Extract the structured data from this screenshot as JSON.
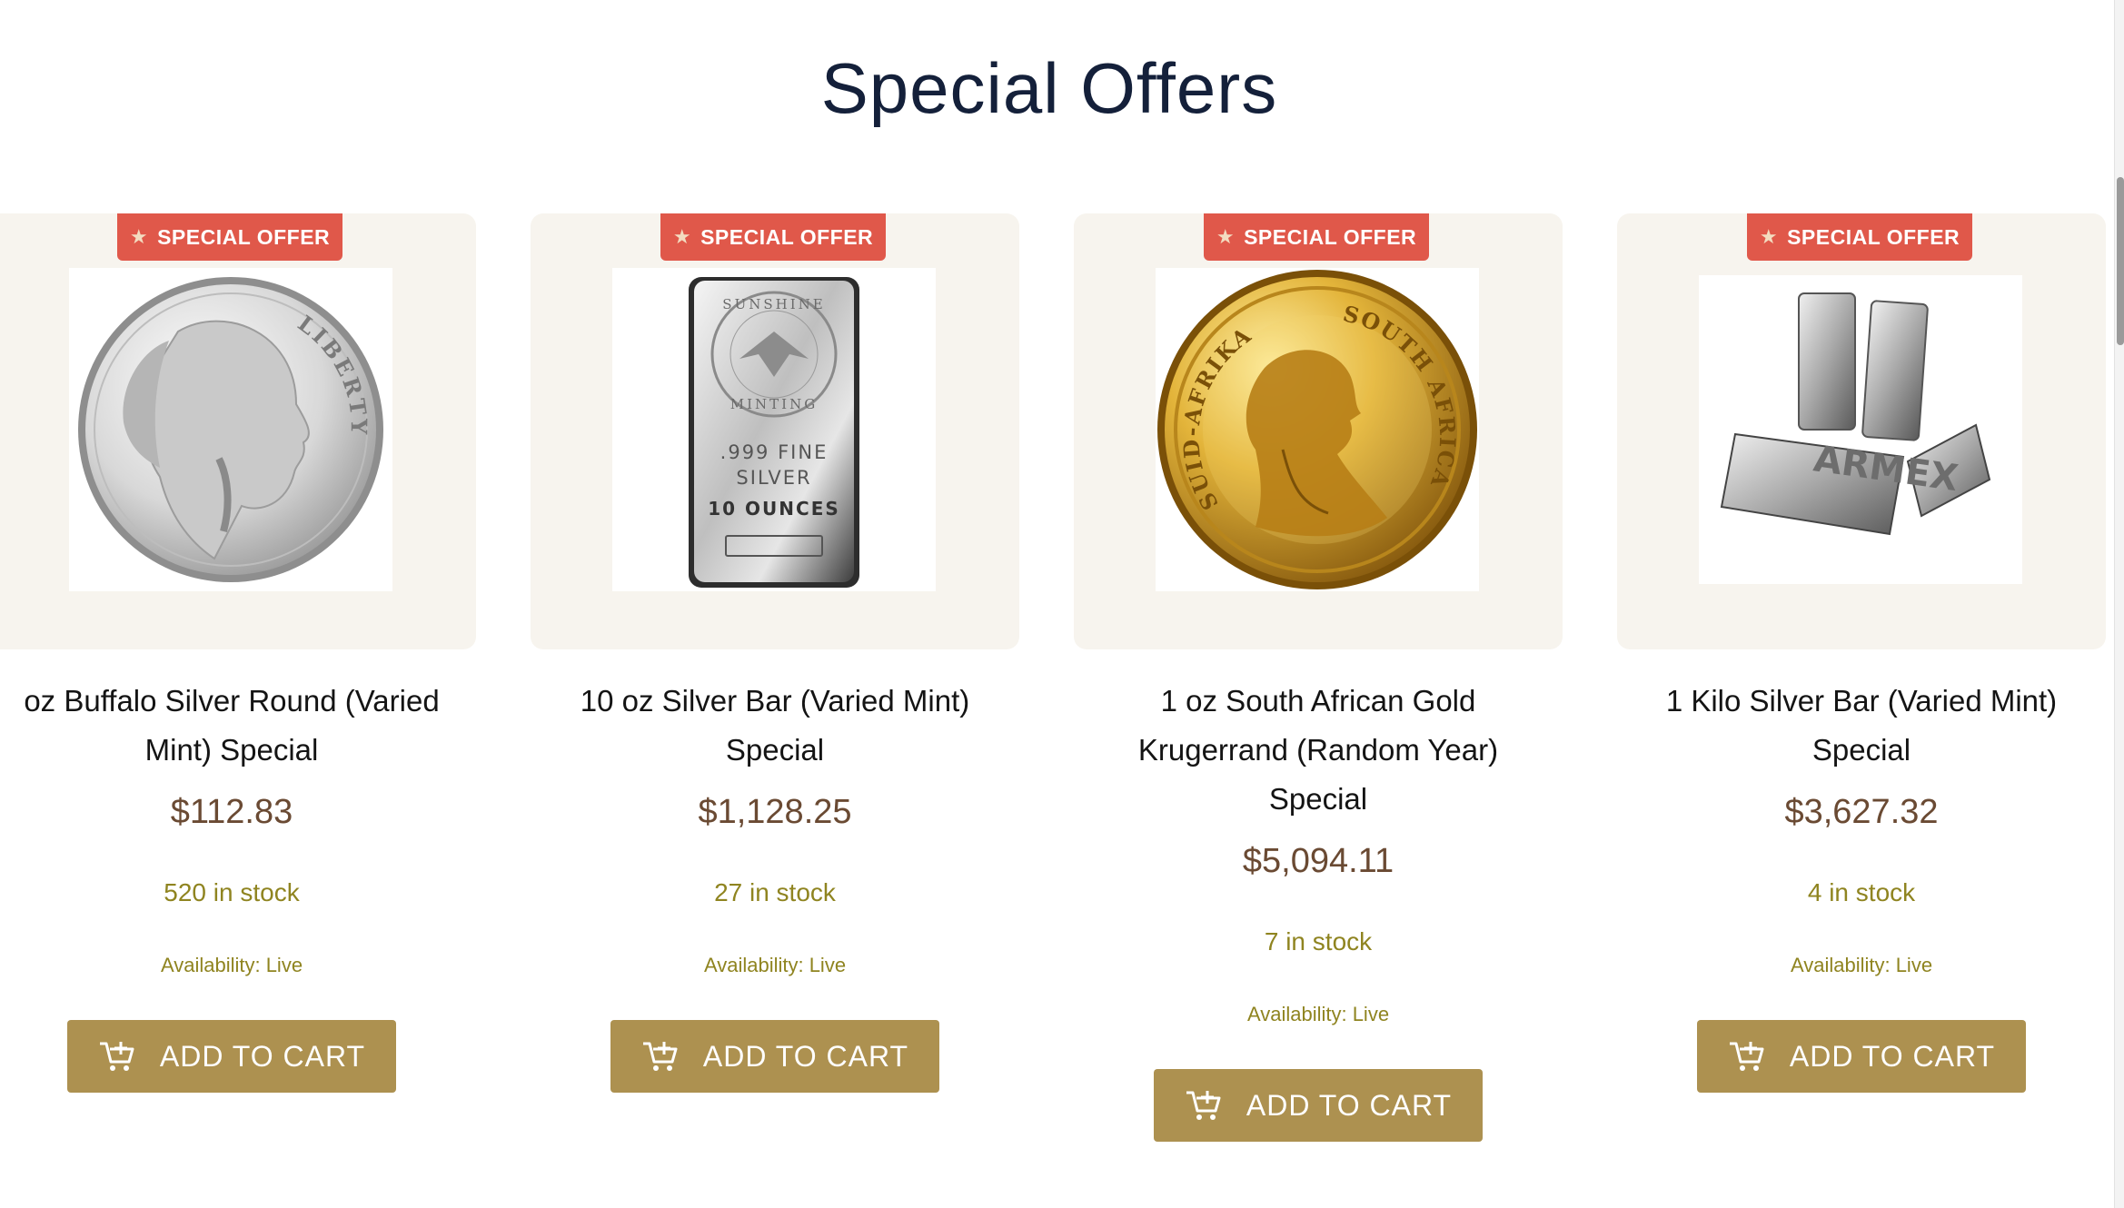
{
  "section": {
    "title": "Special Offers"
  },
  "products": [
    {
      "badge": "SPECIAL OFFER",
      "title_line1": "oz Buffalo Silver Round (Varied",
      "title_line2": "Mint) Special",
      "title_line3": "",
      "price": "$112.83",
      "stock": "520 in stock",
      "availability": "Availability: Live",
      "cart_label": "ADD TO CART",
      "image": "buffalo-silver-round"
    },
    {
      "badge": "SPECIAL OFFER",
      "title_line1": "10 oz Silver Bar (Varied Mint)",
      "title_line2": "Special",
      "title_line3": "",
      "price": "$1,128.25",
      "stock": "27 in stock",
      "availability": "Availability: Live",
      "cart_label": "ADD TO CART",
      "image": "sunshine-silver-bar",
      "bar_text": {
        "mint_top": "SUNSHINE",
        "mint_bottom": "MINTING",
        "fine": ".999 FINE",
        "metal": "SILVER",
        "weight": "10 OUNCES"
      }
    },
    {
      "badge": "SPECIAL OFFER",
      "title_line1": "1 oz South African Gold",
      "title_line2": "Krugerrand (Random Year)",
      "title_line3": "Special",
      "price": "$5,094.11",
      "stock": "7 in stock",
      "availability": "Availability: Live",
      "cart_label": "ADD TO CART",
      "image": "krugerrand-gold-coin",
      "coin_text": {
        "left": "SUID-AFRIKA",
        "right": "SOUTH AFRICA"
      }
    },
    {
      "badge": "SPECIAL OFFER",
      "title_line1": "1 Kilo Silver Bar (Varied Mint)",
      "title_line2": "Special",
      "title_line3": "",
      "price": "$3,627.32",
      "stock": "4 in stock",
      "availability": "Availability: Live",
      "cart_label": "ADD TO CART",
      "image": "kilo-silver-bars",
      "bar_text": {
        "brand": "ARMEX"
      }
    }
  ],
  "coin_text": {
    "liberty": "LIBERTY"
  },
  "colors": {
    "badge": "#e0584a",
    "button": "#ad9150",
    "price": "#6a4a33",
    "stock": "#8f8420",
    "title": "#14203a"
  }
}
